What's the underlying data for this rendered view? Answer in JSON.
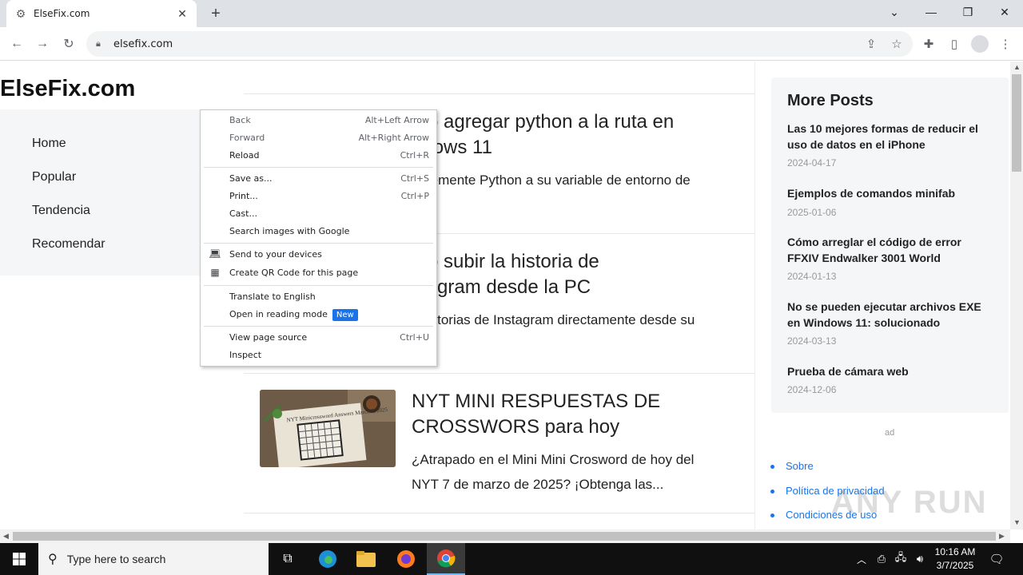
{
  "browser": {
    "tab_title": "ElseFix.com",
    "url": "elsefix.com"
  },
  "site": {
    "logo": "ElseFix.com",
    "nav": [
      "Home",
      "Popular",
      "Tendencia",
      "Recomendar"
    ],
    "posts": [
      {
        "title_line1": "mo agregar python a la ruta en",
        "title_line2": "ndows 11",
        "excerpt": "entemente Python a su variable de entorno de"
      },
      {
        "title_line1": "mo subir la historia de",
        "title_line2": "stagram desde la PC",
        "excerpt": "r historias de Instagram directamente desde su"
      },
      {
        "title_line1": "NYT MINI RESPUESTAS DE",
        "title_line2": "CROSSWORS para hoy",
        "excerpt_line1": "¿Atrapado en el Mini Mini Crosword de hoy del",
        "excerpt_line2": "NYT 7 de marzo de 2025? ¡Obtenga las...",
        "thumb_text": "NYT Minicrossword Answers March 7, 2025"
      }
    ],
    "sidebar": {
      "heading": "More Posts",
      "posts": [
        {
          "line1": "Las 10 mejores formas de reducir el",
          "line2": "uso de datos en el iPhone",
          "date": "2024-04-17"
        },
        {
          "line1": "Ejemplos de comandos minifab",
          "line2": "",
          "date": "2025-01-06"
        },
        {
          "line1": "Cómo arreglar el código de error",
          "line2": "FFXIV Endwalker 3001 World",
          "date": "2024-01-13"
        },
        {
          "line1": "No se pueden ejecutar archivos EXE",
          "line2": "en Windows 11: solucionado",
          "date": "2024-03-13"
        },
        {
          "line1": "Prueba de cámara web",
          "line2": "",
          "date": "2024-12-06"
        }
      ]
    },
    "ad_label": "ad",
    "footer_links": [
      "Sobre",
      "Política de privacidad",
      "Condiciones de uso"
    ],
    "watermark": "ANY RUN"
  },
  "context_menu": {
    "items": [
      {
        "label": "Back",
        "shortcut": "Alt+Left Arrow"
      },
      {
        "label": "Forward",
        "shortcut": "Alt+Right Arrow"
      },
      {
        "label": "Reload",
        "shortcut": "Ctrl+R"
      },
      {
        "label": "Save as...",
        "shortcut": "Ctrl+S"
      },
      {
        "label": "Print...",
        "shortcut": "Ctrl+P"
      },
      {
        "label": "Cast...",
        "shortcut": ""
      },
      {
        "label": "Search images with Google",
        "shortcut": ""
      },
      {
        "label": "Send to your devices",
        "shortcut": ""
      },
      {
        "label": "Create QR Code for this page",
        "shortcut": ""
      },
      {
        "label": "Translate to English",
        "shortcut": ""
      },
      {
        "label": "Open in reading mode",
        "shortcut": "",
        "badge": "New"
      },
      {
        "label": "View page source",
        "shortcut": "Ctrl+U"
      },
      {
        "label": "Inspect",
        "shortcut": ""
      }
    ]
  },
  "taskbar": {
    "search_placeholder": "Type here to search",
    "time": "10:16 AM",
    "date": "3/7/2025"
  }
}
